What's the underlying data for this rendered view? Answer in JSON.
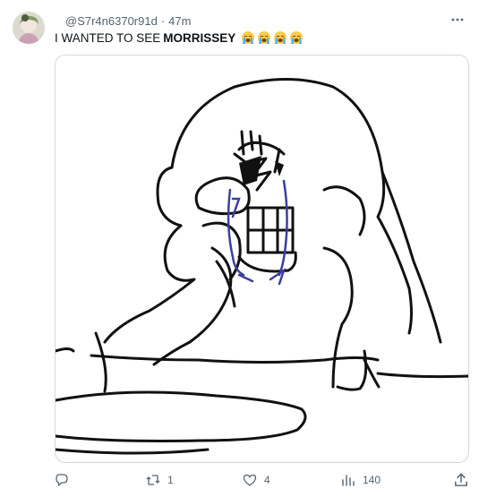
{
  "tweet": {
    "handle": "@S7r4n6370r91d",
    "separator": "·",
    "time": "47m",
    "text_prefix": "I WANTED TO SEE",
    "text_bold": "MORRISSEY",
    "emojis": [
      "loudly-crying-face",
      "loudly-crying-face",
      "loudly-crying-face",
      "loudly-crying-face"
    ]
  },
  "actions": {
    "reply_count": "",
    "retweet_count": "1",
    "like_count": "4",
    "views_count": "140"
  },
  "colors": {
    "text": "#0f1419",
    "muted": "#536471",
    "border": "#cfd9de",
    "emoji_face": "#ffcc4d",
    "tears": "#5dadec",
    "drawing_blue": "#3b3f9e"
  }
}
